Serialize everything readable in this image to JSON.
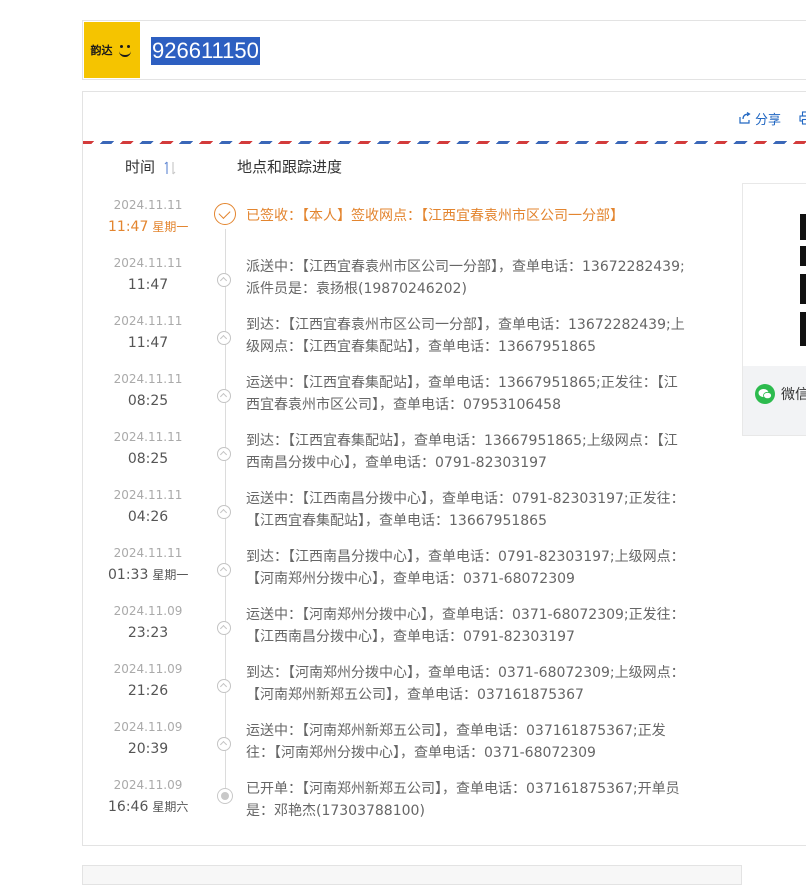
{
  "logo": {
    "text": "韵达"
  },
  "tracking_number": "926611150",
  "actions": {
    "share_label": "分享"
  },
  "columns": {
    "time": "时间",
    "location": "地点和跟踪进度"
  },
  "side": {
    "wechat_label": "微信"
  },
  "colors": {
    "accent": "#e3852f",
    "link": "#2167c2",
    "brand": "#f5c400",
    "wechat": "#2dbb4e"
  },
  "events": [
    {
      "date": "2024.11.11",
      "time": "11:47",
      "weekday": "星期一",
      "desc": "已签收：【本人】签收网点：【江西宜春袁州市区公司一分部】"
    },
    {
      "date": "2024.11.11",
      "time": "11:47",
      "weekday": "",
      "desc": "派送中：【江西宜春袁州市区公司一分部】，查单电话：13672282439;派件员是：袁扬根(19870246202)"
    },
    {
      "date": "2024.11.11",
      "time": "11:47",
      "weekday": "",
      "desc": "到达：【江西宜春袁州市区公司一分部】，查单电话：13672282439;上级网点：【江西宜春集配站】，查单电话：13667951865"
    },
    {
      "date": "2024.11.11",
      "time": "08:25",
      "weekday": "",
      "desc": "运送中：【江西宜春集配站】，查单电话：13667951865;正发往：【江西宜春袁州市区公司】，查单电话：07953106458"
    },
    {
      "date": "2024.11.11",
      "time": "08:25",
      "weekday": "",
      "desc": "到达：【江西宜春集配站】，查单电话：13667951865;上级网点：【江西南昌分拨中心】，查单电话：0791-82303197"
    },
    {
      "date": "2024.11.11",
      "time": "04:26",
      "weekday": "",
      "desc": "运送中：【江西南昌分拨中心】，查单电话：0791-82303197;正发往：【江西宜春集配站】，查单电话：13667951865"
    },
    {
      "date": "2024.11.11",
      "time": "01:33",
      "weekday": "星期一",
      "desc": "到达：【江西南昌分拨中心】，查单电话：0791-82303197;上级网点：【河南郑州分拨中心】，查单电话：0371-68072309"
    },
    {
      "date": "2024.11.09",
      "time": "23:23",
      "weekday": "",
      "desc": "运送中：【河南郑州分拨中心】，查单电话：0371-68072309;正发往：【江西南昌分拨中心】，查单电话：0791-82303197"
    },
    {
      "date": "2024.11.09",
      "time": "21:26",
      "weekday": "",
      "desc": "到达：【河南郑州分拨中心】，查单电话：0371-68072309;上级网点：【河南郑州新郑五公司】，查单电话：037161875367"
    },
    {
      "date": "2024.11.09",
      "time": "20:39",
      "weekday": "",
      "desc": "运送中：【河南郑州新郑五公司】，查单电话：037161875367;正发往：【河南郑州分拨中心】，查单电话：0371-68072309"
    },
    {
      "date": "2024.11.09",
      "time": "16:46",
      "weekday": "星期六",
      "desc": "已开单：【河南郑州新郑五公司】，查单电话：037161875367;开单员是：邓艳杰(17303788100)"
    }
  ]
}
